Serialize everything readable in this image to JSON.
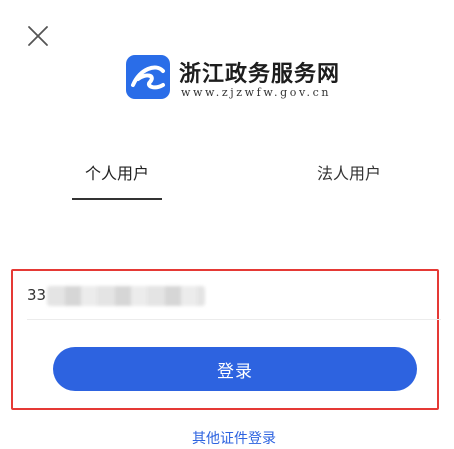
{
  "header": {
    "close_icon": "close-icon"
  },
  "brand": {
    "logo_icon": "zhejiang-gov-logo-icon",
    "name": "浙江政务服务网",
    "url": "www.zjzwfw.gov.cn"
  },
  "tabs": [
    {
      "label": "个人用户",
      "active": true
    },
    {
      "label": "法人用户",
      "active": false
    }
  ],
  "login": {
    "id_value": "33",
    "login_label": "登录"
  },
  "footer": {
    "other_login_label": "其他证件登录"
  },
  "colors": {
    "primary": "#2d63e0",
    "highlight_border": "#e53935",
    "logo_bg": "#2a6de8"
  }
}
